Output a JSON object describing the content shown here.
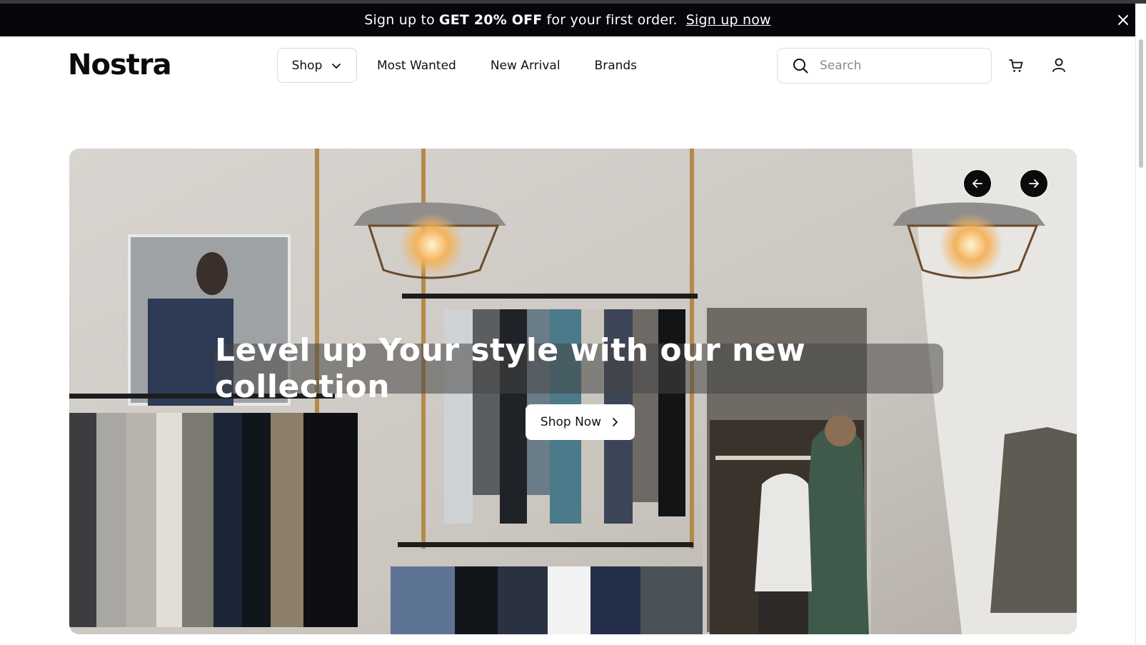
{
  "announcement": {
    "prefix": "Sign up to",
    "highlight": "GET 20% OFF",
    "suffix": "for your first order.",
    "link": "Sign up now",
    "close_icon": "close-icon"
  },
  "header": {
    "logo": "Nostra",
    "nav": {
      "shop_label": "Shop",
      "items": [
        "Most Wanted",
        "New Arrival",
        "Brands"
      ]
    },
    "search": {
      "placeholder": "Search",
      "icon": "search-icon"
    },
    "cart_icon": "cart-icon",
    "user_icon": "user-icon"
  },
  "hero": {
    "headline": "Level up Your style with our new collection",
    "cta_label": "Shop Now",
    "prev_icon": "arrow-left-icon",
    "next_icon": "arrow-right-icon"
  },
  "colors": {
    "announcement_bg": "#05070c",
    "accent": "#0b0b0b",
    "headline_overlay": "rgba(70,70,70,0.55)"
  }
}
